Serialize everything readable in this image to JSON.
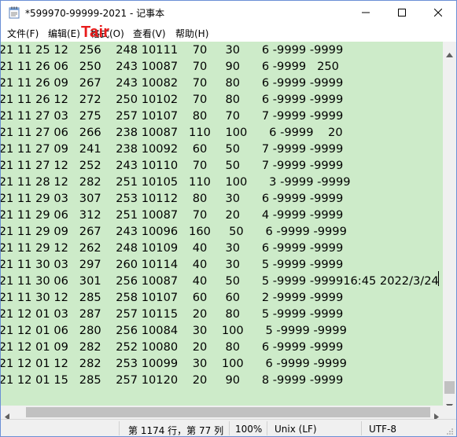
{
  "window": {
    "title": "*599970-99999-2021 - 记事本"
  },
  "overlay_text": "Tair",
  "menu": [
    {
      "label": "文件(F)"
    },
    {
      "label": "编辑(E)"
    },
    {
      "label": "格式(O)"
    },
    {
      "label": "查看(V)"
    },
    {
      "label": "帮助(H)"
    }
  ],
  "editor": {
    "lines": [
      ")21 11 25 12   256    248 10111    70     30      6 -9999 -9999",
      ")21 11 26 06   250    243 10087    70     90      6 -9999   250",
      ")21 11 26 09   267    243 10082    70     80      6 -9999 -9999",
      ")21 11 26 12   272    250 10102    70     80      6 -9999 -9999",
      ")21 11 27 03   275    257 10107    80     70      7 -9999 -9999",
      ")21 11 27 06   266    238 10087   110    100      6 -9999    20",
      ")21 11 27 09   241    238 10092    60     50      7 -9999 -9999",
      ")21 11 27 12   252    243 10110    70     50      7 -9999 -9999",
      ")21 11 28 12   282    251 10105   110    100      3 -9999 -9999",
      ")21 11 29 03   307    253 10112    80     30      6 -9999 -9999",
      ")21 11 29 06   312    251 10087    70     20      4 -9999 -9999",
      ")21 11 29 09   267    243 10096   160     50      6 -9999 -9999",
      ")21 11 29 12   262    248 10109    40     30      6 -9999 -9999",
      ")21 11 30 03   297    260 10114    40     30      5 -9999 -9999",
      ")21 11 30 06   301    256 10087    40     50      5 -9999 -999916:45 2022/3/24",
      ")21 11 30 12   285    258 10107    60     60      2 -9999 -9999",
      ")21 12 01 03   287    257 10115    20     80      5 -9999 -9999",
      ")21 12 01 06   280    256 10084    30    100      5 -9999 -9999",
      ")21 12 01 09   282    252 10080    20     80      6 -9999 -9999",
      ")21 12 01 12   282    253 10099    30    100      6 -9999 -9999",
      ")21 12 01 15   285    257 10120    20     90      8 -9999 -9999"
    ]
  },
  "status": {
    "position": "第 1174 行，第 77 列",
    "zoom": "100%",
    "line_ending": "Unix (LF)",
    "encoding": "UTF-8"
  },
  "colors": {
    "editor_background": "#cdebc9",
    "overlay_text": "#e81c1c"
  }
}
